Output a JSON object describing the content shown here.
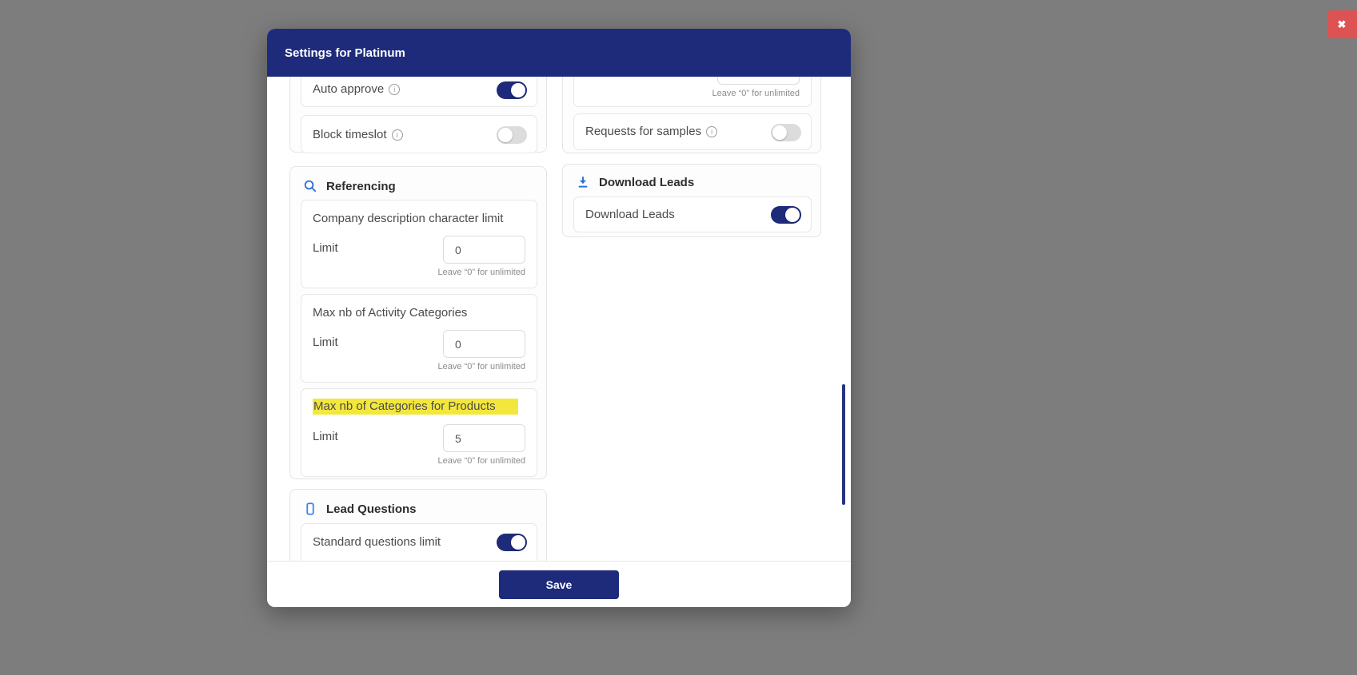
{
  "colors": {
    "navy": "#1e2b7b",
    "accent_blue": "#2a6fd6",
    "highlight_yellow": "#f3e73b",
    "close_red": "#dd5353",
    "page_background": "#7d7d7d"
  },
  "icons": {
    "close": "✖",
    "info": "i",
    "search": "magnifier-glyph",
    "lead_questions": "mobile-phone-outline",
    "download": "down-arrow-with-bar"
  },
  "modal": {
    "title": "Settings for Platinum",
    "footer": {
      "save_label": "Save"
    },
    "left": {
      "toggle_cards": [
        {
          "label": "Auto approve",
          "on": true
        },
        {
          "label": "Block timeslot",
          "on": false
        }
      ],
      "referencing": {
        "title": "Referencing",
        "cards": [
          {
            "title": "Company description character limit",
            "field_label": "Limit",
            "value": "0",
            "helper": "Leave “0” for unlimited"
          },
          {
            "title": "Max nb of Activity Categories",
            "field_label": "Limit",
            "value": "0",
            "helper": "Leave “0” for unlimited"
          },
          {
            "title": "Max nb of Categories for Products",
            "field_label": "Limit",
            "value": "5",
            "helper": "Leave “0” for unlimited"
          }
        ]
      },
      "lead_questions": {
        "title": "Lead Questions",
        "toggle_card": {
          "label": "Standard questions limit",
          "on": true
        }
      }
    },
    "right": {
      "partial_card": {
        "helper": "Leave “0” for unlimited"
      },
      "requests_card": {
        "label": "Requests for samples",
        "on": false
      },
      "download_leads": {
        "title": "Download Leads",
        "toggle_card": {
          "label": "Download Leads",
          "on": true
        }
      }
    }
  }
}
